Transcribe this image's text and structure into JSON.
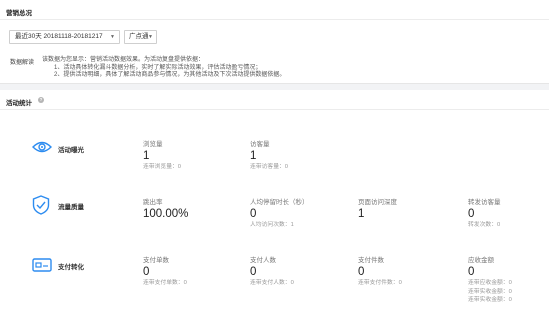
{
  "header": {
    "title": "营销总况"
  },
  "filters": {
    "date_range": "最近30天 20181118-20181217",
    "channel": "广点通"
  },
  "interpretation": {
    "label": "数据解读",
    "lines": [
      "该数据为您显示：营销活动数据效果。为活动复盘提供依据：",
      "1、活动具体转化漏斗数据分析，实时了解实际活动效果，评估活动盈亏情况；",
      "2、提供活动明细，具体了解活动商品参与情况，为其他活动及下次活动提供数据依据。"
    ]
  },
  "stats": {
    "title": "活动统计",
    "help_icon": "question-circle-icon",
    "rows": [
      {
        "label": "活动曝光",
        "icon": "eye-icon",
        "metrics": [
          {
            "label": "浏览量",
            "value": "1",
            "subs": [
              "连带浏览量：0"
            ]
          },
          {
            "label": "访客量",
            "value": "1",
            "subs": [
              "连带访客量：0"
            ]
          }
        ]
      },
      {
        "label": "流量质量",
        "icon": "shield-check-icon",
        "metrics": [
          {
            "label": "跳出率",
            "value": "100.00%",
            "subs": []
          },
          {
            "label": "人均停留时长（秒）",
            "value": "0",
            "subs": [
              "人均访问次数：1"
            ]
          },
          {
            "label": "页面访问深度",
            "value": "1",
            "subs": []
          },
          {
            "label": "转发访客量",
            "value": "0",
            "subs": [
              "转发次数：0"
            ]
          }
        ]
      },
      {
        "label": "支付转化",
        "icon": "card-icon",
        "metrics": [
          {
            "label": "支付单数",
            "value": "0",
            "subs": [
              "连带支付单数：0"
            ]
          },
          {
            "label": "支付人数",
            "value": "0",
            "subs": [
              "连带支付人数：0"
            ]
          },
          {
            "label": "支付件数",
            "value": "0",
            "subs": [
              "连带支付件数：0"
            ]
          },
          {
            "label": "应收金额",
            "value": "0",
            "subs": [
              "连带应收金额：0",
              "连带实收金额：0",
              "连带实收金额：0"
            ]
          }
        ]
      }
    ]
  },
  "colors": {
    "icon": "#2d8cf0",
    "accent": "#1e88e5"
  }
}
